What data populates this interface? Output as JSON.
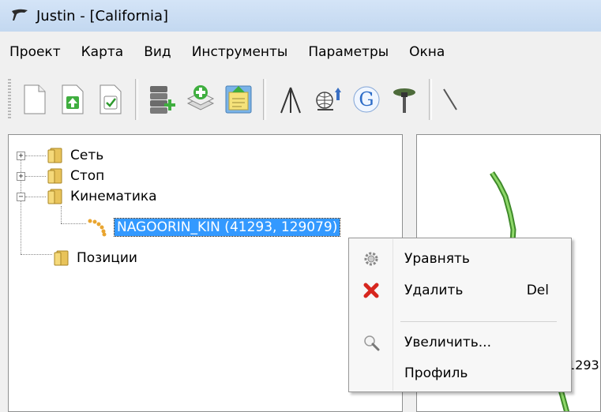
{
  "window": {
    "title": "Justin - [California]"
  },
  "menubar": {
    "items": [
      "Проект",
      "Карта",
      "Вид",
      "Инструменты",
      "Параметры",
      "Окна"
    ]
  },
  "toolbar": {
    "icons": [
      "new-document-icon",
      "open-document-icon",
      "check-document-icon",
      "database-add-icon",
      "layer-add-icon",
      "import-data-icon",
      "tripod-icon",
      "globe-antenna-icon",
      "google-icon",
      "gps-receiver-icon",
      "line-tool-icon"
    ]
  },
  "tree": {
    "items": [
      {
        "label": "Сеть",
        "expander": "+"
      },
      {
        "label": "Стоп",
        "expander": "+"
      },
      {
        "label": "Кинематика",
        "expander": "−"
      },
      {
        "label": "NAGOORIN_KIN (41293, 129079)",
        "selected": true
      },
      {
        "label": "Позиции"
      }
    ]
  },
  "map": {
    "partial_label": "1293"
  },
  "context_menu": {
    "items": [
      {
        "label": "Уравнять",
        "icon": "gear-icon",
        "shortcut": ""
      },
      {
        "label": "Удалить",
        "icon": "delete-x-icon",
        "shortcut": "Del"
      },
      {
        "label": "Увеличить...",
        "icon": "magnifier-icon",
        "shortcut": ""
      },
      {
        "label": "Профиль",
        "icon": "",
        "shortcut": ""
      }
    ]
  },
  "colors": {
    "selection": "#3399ff",
    "titlebar": "#c9dcf2",
    "track": "#6fc24b"
  }
}
